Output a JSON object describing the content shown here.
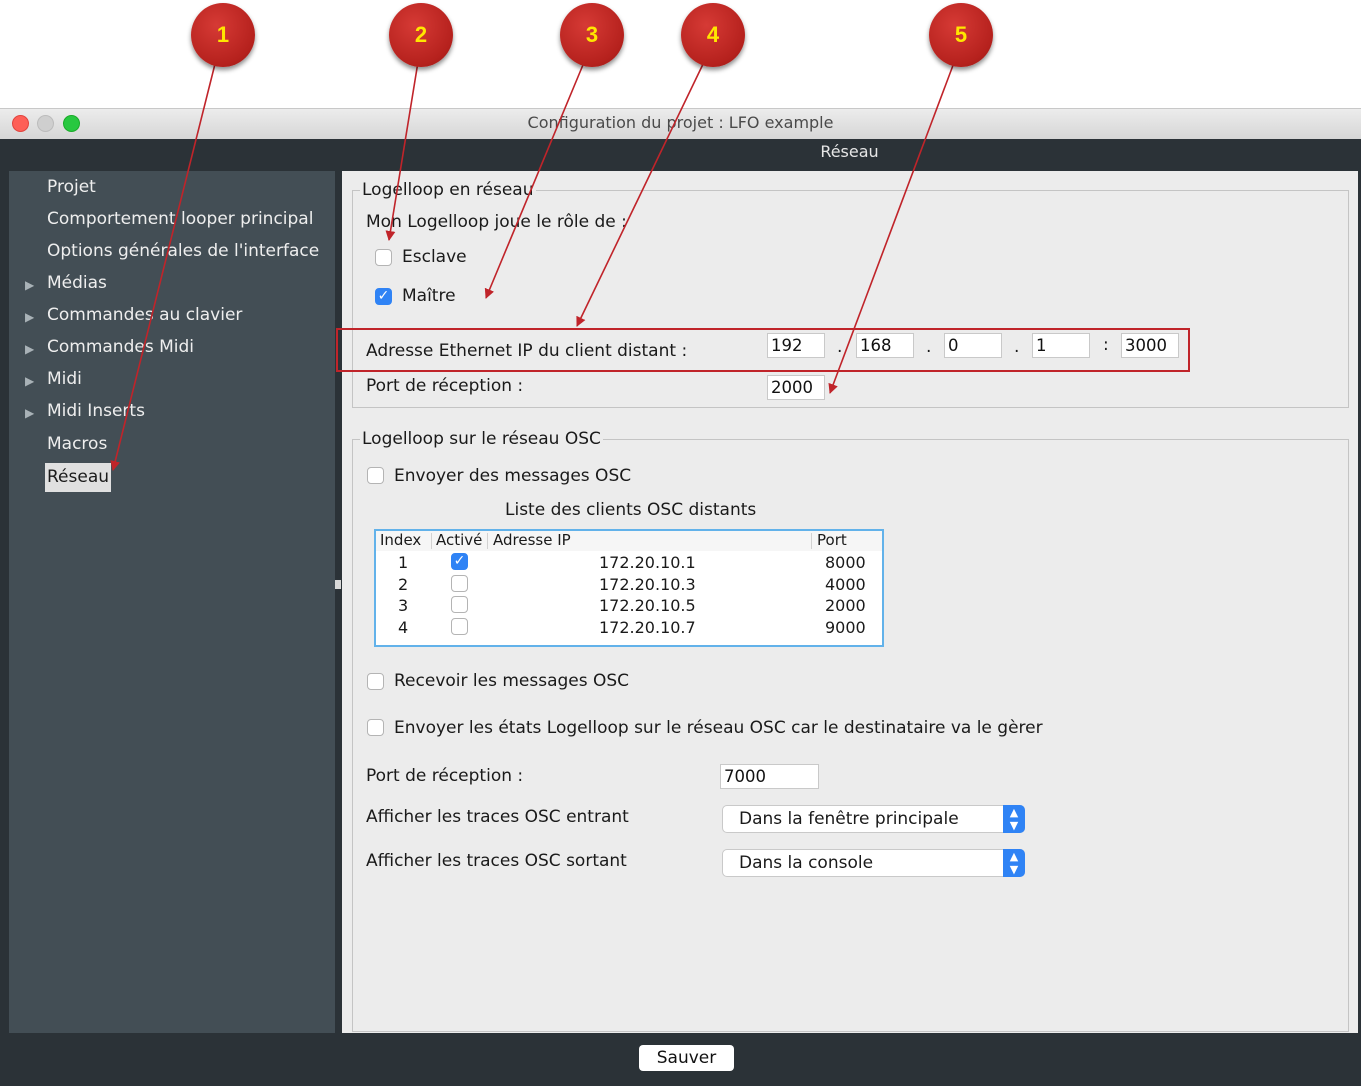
{
  "window": {
    "title": "Configuration du projet : LFO example",
    "section_title": "Réseau"
  },
  "sidebar": {
    "items": [
      {
        "label": "Projet",
        "expandable": false
      },
      {
        "label": "Comportement looper principal",
        "expandable": false
      },
      {
        "label": "Options générales de l'interface",
        "expandable": false
      },
      {
        "label": "Médias",
        "expandable": true
      },
      {
        "label": "Commandes au clavier",
        "expandable": true
      },
      {
        "label": "Commandes Midi",
        "expandable": true
      },
      {
        "label": "Midi",
        "expandable": true
      },
      {
        "label": "Midi Inserts",
        "expandable": true
      },
      {
        "label": "Macros",
        "expandable": false
      },
      {
        "label": "Réseau",
        "expandable": false,
        "selected": true
      }
    ],
    "expand_glyph": "▶"
  },
  "network": {
    "group_title": "Logelloop en réseau",
    "role_label": "Mon Logelloop joue le rôle de :",
    "slave_label": "Esclave",
    "slave_checked": false,
    "master_label": "Maître",
    "master_checked": true,
    "ip_label": "Adresse Ethernet IP du client distant :",
    "ip": [
      "192",
      "168",
      "0",
      "1"
    ],
    "ip_sep": ".",
    "port_sep": ":",
    "ip_port": "3000",
    "receive_port_label": "Port de réception :",
    "receive_port": "2000"
  },
  "osc": {
    "group_title": "Logelloop sur le réseau OSC",
    "send_label": "Envoyer des messages OSC",
    "send_checked": false,
    "clients_title": "Liste des clients OSC distants",
    "columns": [
      "Index",
      "Activé",
      "Adresse IP",
      "Port"
    ],
    "clients": [
      {
        "index": "1",
        "active": true,
        "ip": "172.20.10.1",
        "port": "8000"
      },
      {
        "index": "2",
        "active": false,
        "ip": "172.20.10.3",
        "port": "4000"
      },
      {
        "index": "3",
        "active": false,
        "ip": "172.20.10.5",
        "port": "2000"
      },
      {
        "index": "4",
        "active": false,
        "ip": "172.20.10.7",
        "port": "9000"
      }
    ],
    "receive_label": "Recevoir les messages OSC",
    "receive_checked": false,
    "send_states_label": "Envoyer les états Logelloop sur le réseau OSC car le destinataire va le gèrer",
    "send_states_checked": false,
    "port_label": "Port de réception :",
    "port_value": "7000",
    "trace_in_label": "Afficher les traces OSC entrant",
    "trace_in_value": "Dans la fenêtre principale",
    "trace_out_label": "Afficher les traces OSC sortant",
    "trace_out_value": "Dans la console"
  },
  "footer": {
    "save_label": "Sauver"
  },
  "annotations": {
    "badges": [
      "1",
      "2",
      "3",
      "4",
      "5"
    ],
    "badge_color": "#b5211d",
    "badge_text_color": "#ffe600",
    "box_color": "#c0242a"
  },
  "colors": {
    "accent": "#2f83f5",
    "sidebar_bg": "#434e55",
    "dark_bg": "#2b3237",
    "panel_bg": "#ececec"
  }
}
